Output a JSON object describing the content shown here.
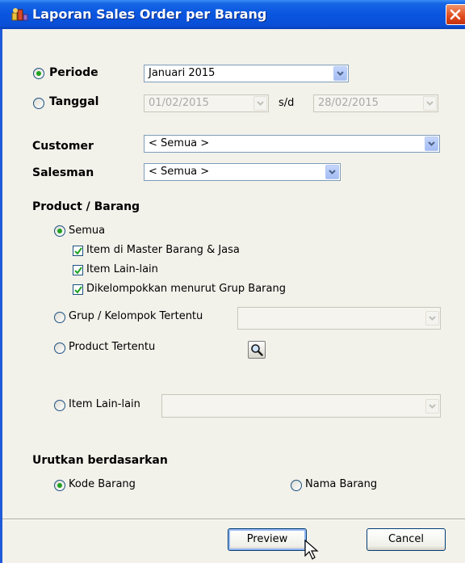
{
  "window": {
    "title": "Laporan Sales Order per Barang"
  },
  "periode": {
    "periode_label": "Periode",
    "periode_value": "Januari 2015",
    "tanggal_label": "Tanggal",
    "tanggal_from": "01/02/2015",
    "sd_label": "s/d",
    "tanggal_to": "28/02/2015"
  },
  "customer": {
    "label": "Customer",
    "value": "< Semua >"
  },
  "salesman": {
    "label": "Salesman",
    "value": "< Semua >"
  },
  "product": {
    "heading": "Product / Barang",
    "semua_label": "Semua",
    "checks": [
      {
        "label": "Item di Master Barang & Jasa",
        "checked": true
      },
      {
        "label": "Item Lain-lain",
        "checked": true
      },
      {
        "label": "Dikelompokkan menurut Grup Barang",
        "checked": true
      }
    ],
    "grup_label": "Grup / Kelompok Tertentu",
    "grup_value": "",
    "product_tertentu_label": "Product Tertentu",
    "item_lain_label": "Item Lain-lain",
    "item_lain_value": ""
  },
  "urutkan": {
    "heading": "Urutkan berdasarkan",
    "kode_label": "Kode Barang",
    "nama_label": "Nama Barang"
  },
  "buttons": {
    "preview": "Preview",
    "cancel": "Cancel"
  },
  "icons": [
    "app-icon",
    "close-icon",
    "dropdown-arrow-icon",
    "search-icon",
    "mouse-cursor-icon"
  ],
  "colors": {
    "titlebar": "#0a4fd6",
    "radio_selected": "#21a121",
    "background": "#f2f1ea"
  }
}
